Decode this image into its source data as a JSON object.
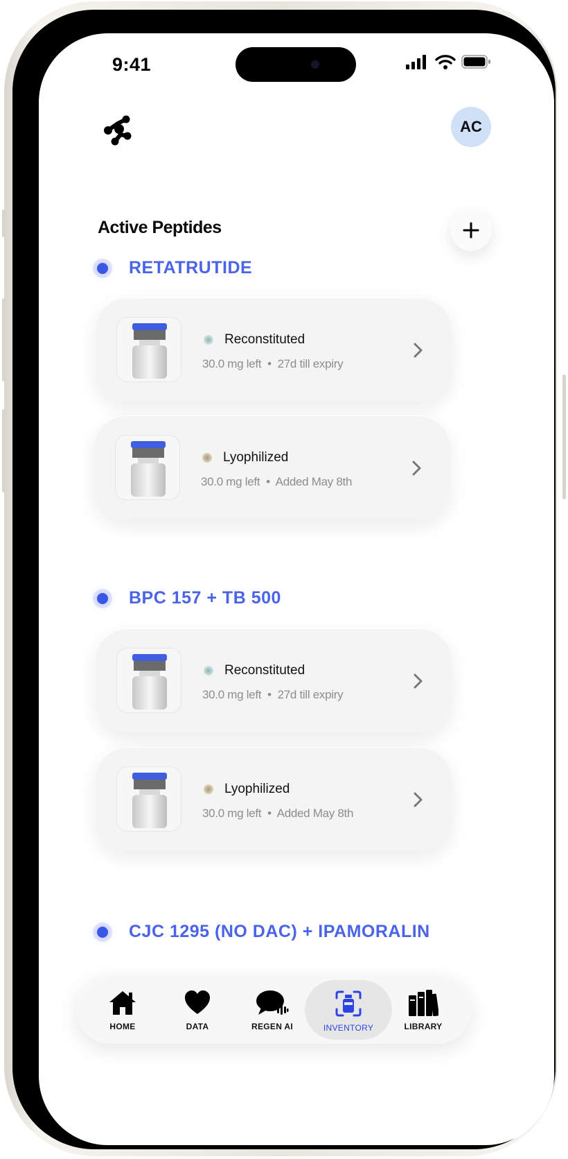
{
  "status": {
    "time": "9:41"
  },
  "header": {
    "avatar_initials": "AC"
  },
  "main": {
    "section_title": "Active Peptides",
    "groups": [
      {
        "name": "RETATRUTIDE",
        "vials": [
          {
            "state": "Reconstituted",
            "amount": "30.0 mg left",
            "detail": "27d till expiry"
          },
          {
            "state": "Lyophilized",
            "amount": "30.0 mg left",
            "detail": "Added May 8th"
          }
        ]
      },
      {
        "name": "BPC 157 + TB 500",
        "vials": [
          {
            "state": "Reconstituted",
            "amount": "30.0 mg left",
            "detail": "27d till expiry"
          },
          {
            "state": "Lyophilized",
            "amount": "30.0 mg left",
            "detail": "Added May 8th"
          }
        ]
      },
      {
        "name": "CJC 1295 (NO DAC) + IPAMORALIN",
        "vials": []
      }
    ]
  },
  "nav": {
    "items": [
      {
        "label": "HOME",
        "icon": "home-icon"
      },
      {
        "label": "DATA",
        "icon": "heart-icon"
      },
      {
        "label": "REGEN AI",
        "icon": "chat-voice-icon"
      },
      {
        "label": "INVENTORY",
        "icon": "vial-scan-icon",
        "active": true
      },
      {
        "label": "LIBRARY",
        "icon": "books-icon"
      }
    ]
  },
  "colors": {
    "accent": "#4a63e8",
    "active_nav": "#2d45e0",
    "avatar_bg": "#cfe0f7"
  }
}
